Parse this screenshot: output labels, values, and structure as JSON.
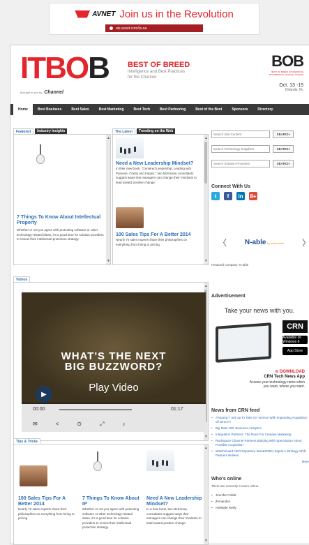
{
  "ad_banner": {
    "brand": "AVNET",
    "tagline": "Join us in the Revolution",
    "url": "ats.avnet.com/lis-na"
  },
  "header": {
    "logo_main": "ITB",
    "logo_tail": "B",
    "logo_letter_o": "O",
    "best_of_breed": "BEST OF BREED",
    "subtitle_line1": "Intelligence and Best Practices",
    "subtitle_line2": "for the Channel",
    "brought_by": "Brought to you by",
    "channel": "Channel",
    "right_logo": "BOB",
    "right_sub1": "BEST OF BREED CONFERENCE",
    "right_sub2": "DISTRIBUTION CHANNEL TRADES",
    "event_date": "Oct. 13 -15",
    "event_location": "Orlando, FL"
  },
  "nav": [
    "Home",
    "Best Business",
    "Best Sales",
    "Best Marketing",
    "Best Tech",
    "Best Partnering",
    "Best of the Best",
    "Sponsors",
    "Directory"
  ],
  "featured": {
    "tabs": [
      "Featured",
      "Industry Insights"
    ],
    "title": "7 Things To Know About Intellectual Property",
    "body": "Whether or not you agree with protecting software or other technology-related ideas, it's a good time for solution providers to review their intellectual protection strategy."
  },
  "latest": {
    "tabs": [
      "The Latest",
      "Trending on the Web"
    ],
    "items": [
      {
        "title": "Need a New Leadership Mindset?",
        "body": "In their new book, \"Centered Leadership: Leading with Purpose, Clarity and Impact,\" two McKinsey consultants suggest ways that managers can change their mindsets to lead toward positive change."
      },
      {
        "title": "100 Sales Tips For A Better 2014",
        "body": "Nearly 70 sales experts share their philosophies on everything from hiring to pricing."
      }
    ]
  },
  "search": [
    {
      "placeholder": "Search Site Content",
      "button": "SEARCH"
    },
    {
      "placeholder": "Search Technology Suppliers",
      "button": "SEARCH"
    },
    {
      "placeholder": "Search Solution Providers",
      "button": "SEARCH"
    }
  ],
  "connect": {
    "title": "Connect With Us",
    "icons": [
      "twitter-icon",
      "facebook-icon",
      "linkedin-icon",
      "googleplus-icon"
    ]
  },
  "featured_company": {
    "name": "N-able",
    "by": "by solarwinds",
    "caption": "Featured company: N-able"
  },
  "videos": {
    "tab": "Videos",
    "overlay1": "WHAT'S THE NEXT",
    "overlay2": "BIG BUZZWORD?",
    "play": "Play Video",
    "time_current": "00:00",
    "time_total": "01:17"
  },
  "advertisement": {
    "label": "Advertisement",
    "headline": "Take your news with you.",
    "logo": "CRN",
    "store1": "Available on Windows 8",
    "store2": "App Store",
    "download": "DOWNLOAD",
    "app_name": "CRN Tech News App",
    "access1": "Access your technology news when",
    "access2": "you want, where you want."
  },
  "news": {
    "title": "News from CRN feed",
    "items": [
      "AT&amp;T Set Up To Take On Verizon With Impending Acquisition Of DirecTV",
      "Big Data 100: Business Analytics",
      "Integration Partners: The Race For Creative Marketing",
      "Rackspace Channel Partners Building With Speculation About Possible Acquisition",
      "WatchGuard CEO Departure Won&#039;t Signal A Strategy Shift, Partners Believe"
    ],
    "more": "More"
  },
  "tips": {
    "tab": "Tips & Tricks",
    "items": [
      {
        "title": "100 Sales Tips For A Better 2014",
        "body": "Nearly 70 sales experts share their philosophies on everything from hiring to pricing."
      },
      {
        "title": "7 Things To Know About IP",
        "body": "Whether or not you agree with protecting software or other technology-related ideas, it's a good time for solution providers to review their intellectual protection strategy."
      },
      {
        "title": "Need A New Leadership Mindset?",
        "body": "In a new book, two McKinsey consultants suggest ways that managers can change their mindsets to lead toward positive change."
      }
    ]
  },
  "who": {
    "title": "Who's online",
    "text": "There are currently 3 users online.",
    "users": [
      "Jennifer Follett",
      "jfernandes",
      "Adelaide Reilly"
    ]
  }
}
